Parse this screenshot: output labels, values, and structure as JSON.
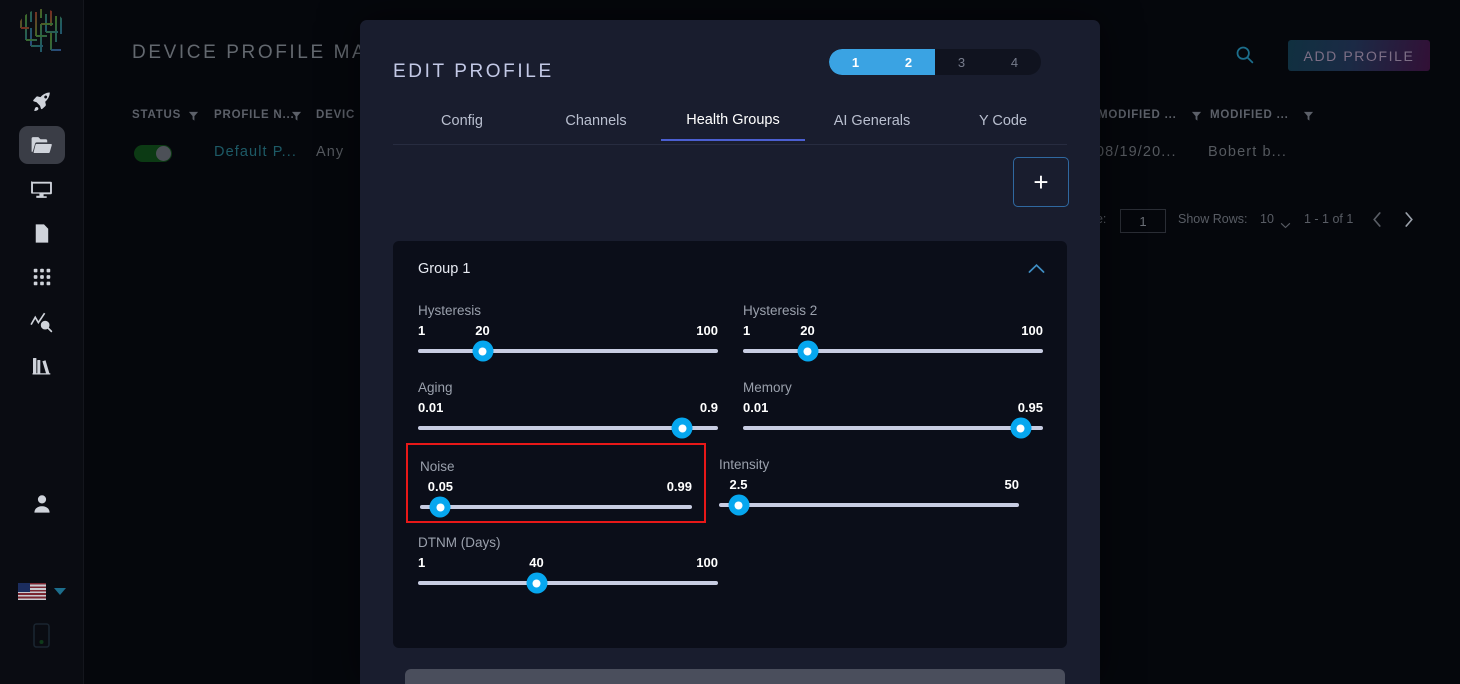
{
  "sidebar": {
    "logo_name": "circuit-logo",
    "items": [
      {
        "name": "rocket",
        "label": "Launch"
      },
      {
        "name": "folder",
        "label": "Profiles",
        "active": true
      },
      {
        "name": "monitor",
        "label": "Devices"
      },
      {
        "name": "sim-card",
        "label": "SIM"
      },
      {
        "name": "grid",
        "label": "Apps"
      },
      {
        "name": "chart-search",
        "label": "Analytics"
      },
      {
        "name": "books",
        "label": "Library"
      }
    ],
    "bottom": [
      {
        "name": "user",
        "label": "Account"
      },
      {
        "name": "flag",
        "label": "Language"
      },
      {
        "name": "mobile",
        "label": "Mobile"
      }
    ]
  },
  "background": {
    "page_title": "DEVICE PROFILE MAN...",
    "add_profile_label": "ADD PROFILE",
    "columns": [
      {
        "label": "STATUS",
        "filter": true
      },
      {
        "label": "PROFILE N...",
        "filter": true
      },
      {
        "label": "DEVIC",
        "filter": false
      },
      {
        "label": "MODIFIED ...",
        "filter": true
      },
      {
        "label": "MODIFIED ...",
        "filter": true
      }
    ],
    "row": {
      "profile_name": "Default P...",
      "device": "Any",
      "modified_date": "08/19/20...",
      "modified_by": "Bobert b..."
    },
    "pagination": {
      "page_label": "ge:",
      "page_value": "1",
      "show_rows_label": "Show Rows:",
      "rows_value": "10",
      "range": "1 - 1 of 1"
    }
  },
  "modal": {
    "title": "EDIT PROFILE",
    "close_label": "×",
    "stepper": {
      "steps": [
        "1",
        "2",
        "3",
        "4"
      ],
      "completed": 2
    },
    "tabs": [
      {
        "label": "Config",
        "active": false
      },
      {
        "label": "Channels",
        "active": false
      },
      {
        "label": "Health Groups",
        "active": true
      },
      {
        "label": "AI Generals",
        "active": false
      },
      {
        "label": "Y Code",
        "active": false
      }
    ],
    "add_group_label": "+",
    "group": {
      "title": "Group 1",
      "expanded": true,
      "sliders": [
        {
          "label": "Hysteresis",
          "min": "1",
          "max": "100",
          "current": "20",
          "fraction": 0.215,
          "highlighted": false
        },
        {
          "label": "Hysteresis 2",
          "min": "1",
          "max": "100",
          "current": "20",
          "fraction": 0.215,
          "highlighted": false
        },
        {
          "label": "Aging",
          "min": "0.01",
          "max": "0.9",
          "current": null,
          "fraction": 0.88,
          "highlighted": false
        },
        {
          "label": "Memory",
          "min": "0.01",
          "max": "0.95",
          "current": null,
          "fraction": 0.925,
          "highlighted": false
        },
        {
          "label": "Noise",
          "min": "0.05",
          "max": "0.99",
          "current": null,
          "fraction": 0.075,
          "highlighted": true
        },
        {
          "label": "Intensity",
          "min": "2.5",
          "max": "50",
          "current": null,
          "fraction": 0.065,
          "highlighted": false
        },
        {
          "label": "DTNM (Days)",
          "min": "1",
          "max": "100",
          "current": "40",
          "fraction": 0.395,
          "highlighted": false
        }
      ]
    }
  },
  "colors": {
    "accent_cyan": "#06a7ef",
    "accent_indigo": "#4b5fd1",
    "highlight_red": "#e81818",
    "modal_bg": "#191d2e",
    "card_bg": "#0b0e19",
    "page_bg": "#05070c"
  }
}
